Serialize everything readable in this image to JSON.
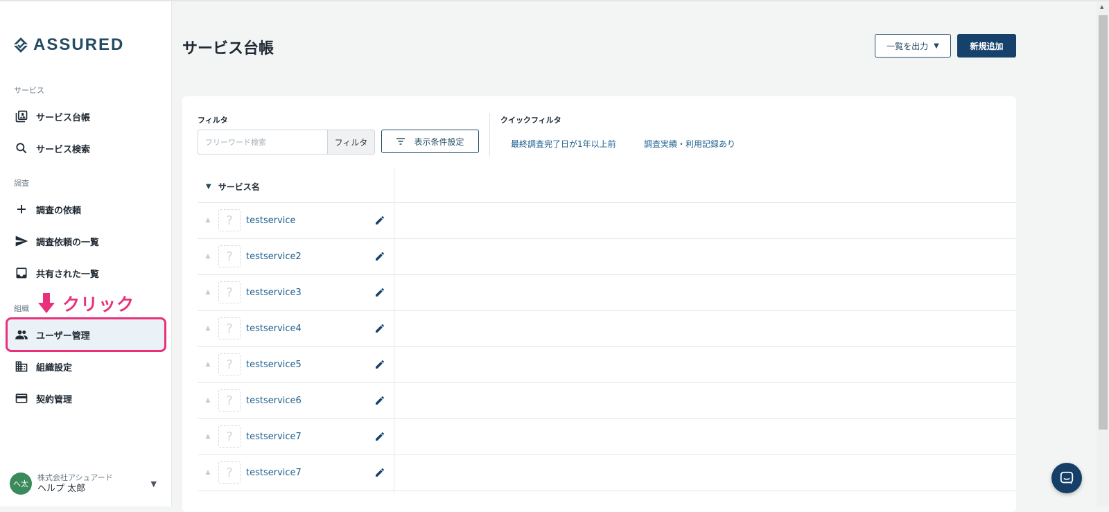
{
  "app": {
    "brand": "ASSURED",
    "brand_color": "#234b63",
    "accent_annotation": "#e8317a"
  },
  "sidebar": {
    "sections": [
      {
        "label": "サービス",
        "items": [
          {
            "label": "サービス台帳",
            "icon": "library-icon"
          },
          {
            "label": "サービス検索",
            "icon": "search-icon"
          }
        ]
      },
      {
        "label": "調査",
        "items": [
          {
            "label": "調査の依頼",
            "icon": "plus-icon"
          },
          {
            "label": "調査依頼の一覧",
            "icon": "send-icon"
          },
          {
            "label": "共有された一覧",
            "icon": "inbox-icon"
          }
        ]
      },
      {
        "label": "組織",
        "items": [
          {
            "label": "ユーザー管理",
            "icon": "people-icon",
            "active": true
          },
          {
            "label": "組織設定",
            "icon": "building-icon"
          },
          {
            "label": "契約管理",
            "icon": "credit-card-icon"
          }
        ]
      }
    ],
    "annotation": {
      "text": "クリック",
      "icon": "down-arrow-icon"
    },
    "user": {
      "avatar_initials": "へ太",
      "company": "株式会社アシュアード",
      "name": "ヘルプ 太郎"
    }
  },
  "header": {
    "title": "サービス台帳",
    "export_button": "一覧を出力",
    "new_button": "新規追加"
  },
  "filter": {
    "label": "フィルタ",
    "search_placeholder": "フリーワード検索",
    "search_value": "",
    "filter_button": "フィルタ",
    "conditions_button": "表示条件設定"
  },
  "quick_filter": {
    "label": "クイックフィルタ",
    "links": [
      "最終調査完了日が1年以上前",
      "調査実績・利用記録あり"
    ]
  },
  "table": {
    "column_header": "サービス名",
    "rows": [
      {
        "name": "testservice"
      },
      {
        "name": "testservice2"
      },
      {
        "name": "testservice3"
      },
      {
        "name": "testservice4"
      },
      {
        "name": "testservice5"
      },
      {
        "name": "testservice6"
      },
      {
        "name": "testservice7"
      },
      {
        "name": "testservice7"
      }
    ],
    "thumb_placeholder": "?"
  }
}
